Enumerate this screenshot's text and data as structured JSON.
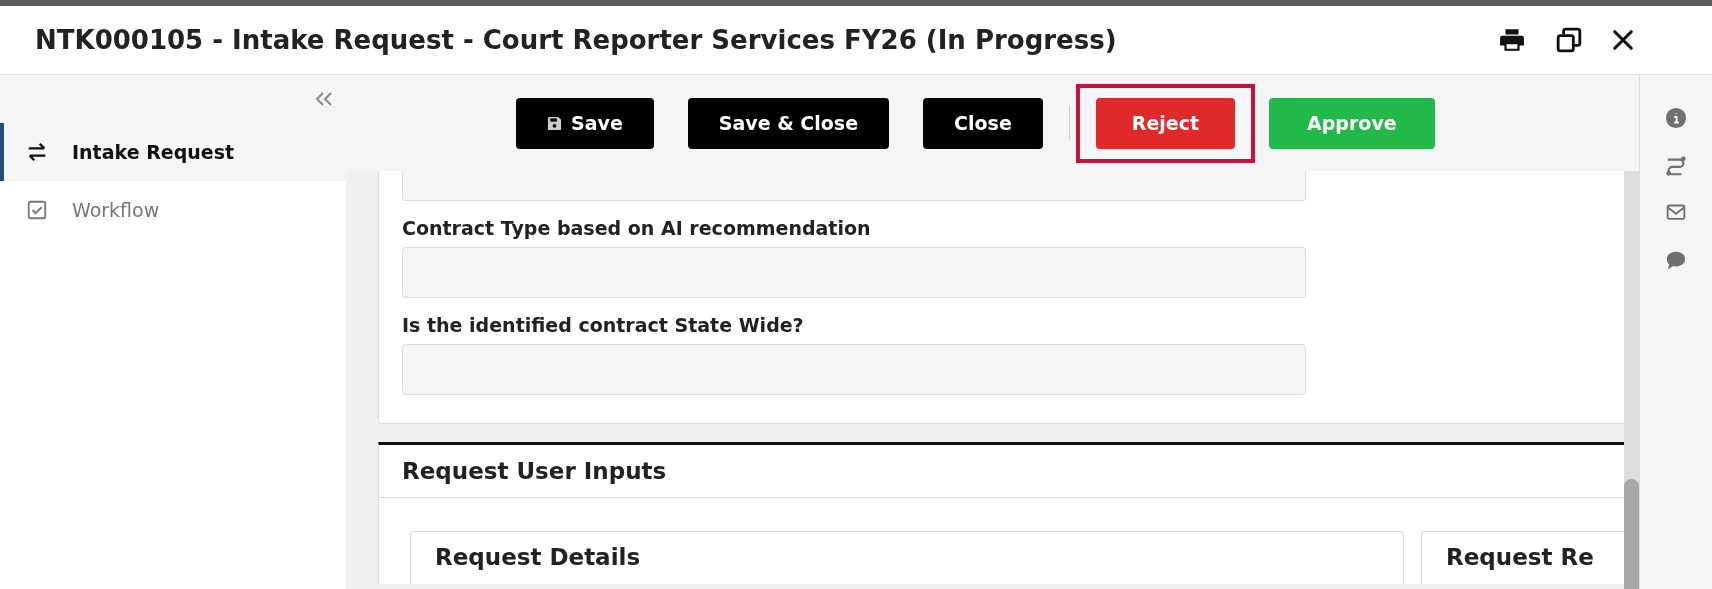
{
  "window": {
    "title": "NTK000105 - Intake Request - Court Reporter Services FY26 (In Progress)"
  },
  "sidebar": {
    "items": [
      {
        "label": "Intake Request",
        "selected": true
      },
      {
        "label": "Workflow",
        "selected": false
      }
    ]
  },
  "toolbar": {
    "buttons": [
      {
        "label": "Save",
        "kind": "dark",
        "icon": true,
        "highlighted": false
      },
      {
        "label": "Save & Close",
        "kind": "dark",
        "icon": false,
        "highlighted": false
      },
      {
        "label": "Close",
        "kind": "dark",
        "icon": false,
        "highlighted": false
      },
      {
        "label": "Reject",
        "kind": "danger",
        "icon": false,
        "highlighted": true
      },
      {
        "label": "Approve",
        "kind": "success",
        "icon": false,
        "highlighted": false
      }
    ]
  },
  "form": {
    "fields": [
      {
        "kind": "clipped"
      },
      {
        "kind": "labeled",
        "label": "Contract Type based on AI recommendation"
      },
      {
        "kind": "labeled",
        "label": "Is the identified contract State Wide?"
      }
    ]
  },
  "sections": [
    {
      "title": "Request User Inputs",
      "cards": [
        {
          "title": "Request Details"
        },
        {
          "title": "Request Re"
        }
      ]
    }
  ]
}
